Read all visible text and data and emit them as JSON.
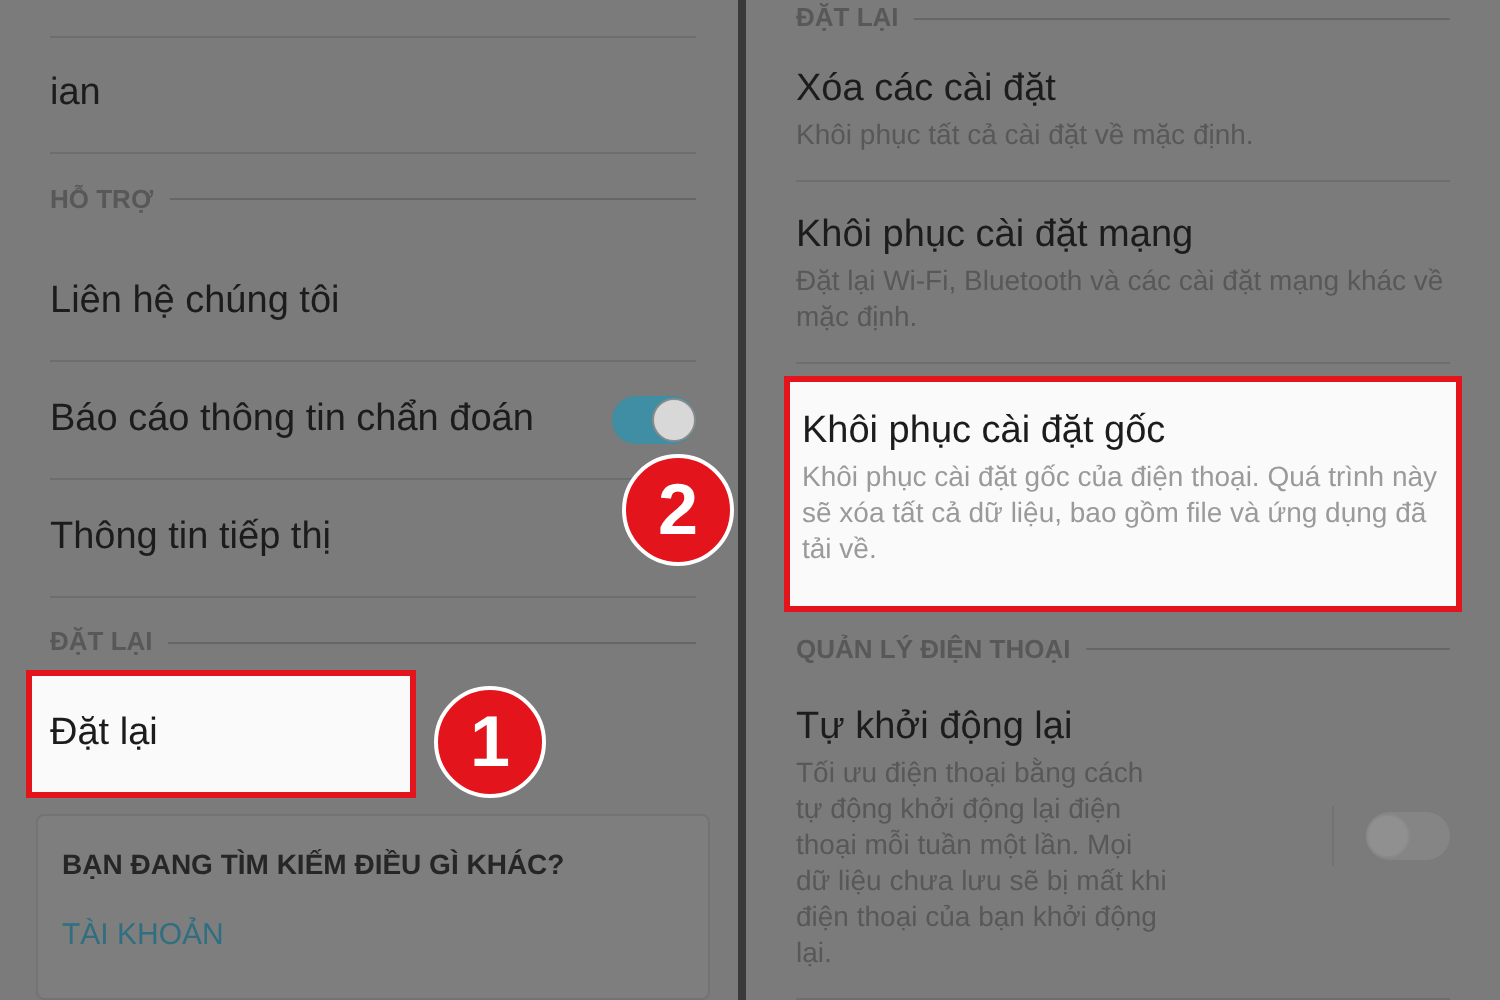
{
  "panels": [
    {
      "items": [
        {
          "kind": "row",
          "title": "ian",
          "highlighted": false
        },
        {
          "kind": "header",
          "label": "HỖ TRỢ"
        },
        {
          "kind": "row",
          "title": "Liên hệ chúng tôi",
          "highlighted": false
        },
        {
          "kind": "row",
          "title": "Báo cáo thông tin chẩn đoán",
          "highlighted": false,
          "switch": {
            "on": true
          }
        },
        {
          "kind": "row",
          "title": "Thông tin tiếp thị",
          "highlighted": false
        },
        {
          "kind": "header",
          "label": "ĐẶT LẠI"
        },
        {
          "kind": "row",
          "title": "Đặt lại",
          "highlighted": true,
          "badge": "1"
        },
        {
          "kind": "card",
          "title": "BẠN ĐANG TÌM KIẾM ĐIỀU GÌ KHÁC?",
          "links": [
            "TÀI KHOẢN"
          ]
        }
      ]
    },
    {
      "items": [
        {
          "kind": "header",
          "label": "ĐẶT LẠI"
        },
        {
          "kind": "row",
          "title": "Xóa các cài đặt",
          "subtitle": "Khôi phục tất cả cài đặt về mặc định.",
          "highlighted": false
        },
        {
          "kind": "row",
          "title": "Khôi phục cài đặt mạng",
          "subtitle": "Đặt lại Wi-Fi, Bluetooth và các cài đặt mạng khác về mặc định.",
          "highlighted": false
        },
        {
          "kind": "row",
          "title": "Khôi phục cài đặt gốc",
          "subtitle": "Khôi phục cài đặt gốc của điện thoại. Quá trình này sẽ xóa tất cả dữ liệu, bao gồm file và ứng dụng đã tải về.",
          "highlighted": true,
          "badge": "2"
        },
        {
          "kind": "header",
          "label": "QUẢN LÝ ĐIỆN THOẠI"
        },
        {
          "kind": "row",
          "title": "Tự khởi động lại",
          "subtitle": "Tối ưu điện thoại bằng cách tự động khởi động lại điện thoại mỗi tuần một lần. Mọi dữ liệu chưa lưu sẽ bị mất khi điện thoại của bạn khởi động lại.",
          "highlighted": false,
          "switch": {
            "on": false
          }
        }
      ]
    }
  ]
}
